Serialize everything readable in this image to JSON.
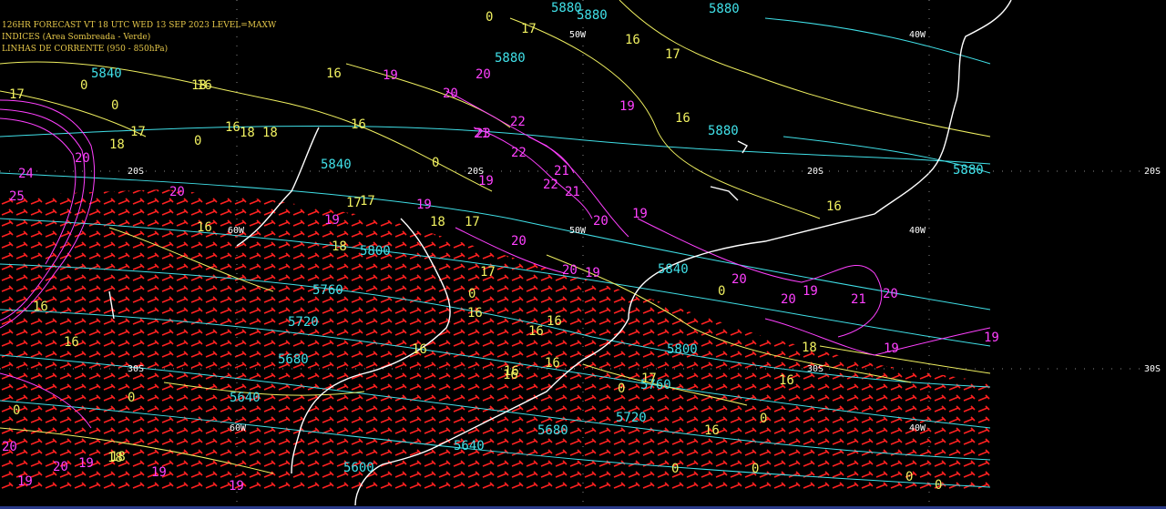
{
  "header": {
    "line1": "126HR FORECAST   VT 18 UTC WED 13 SEP 2023   LEVEL=MAXW",
    "line2": "INDICES (Area Sombreada - Verde)",
    "line3": "LINHAS DE CORRENTE (950 - 850hPa)"
  },
  "colors": {
    "background": "#000000",
    "heights_contour": "#40e0e8",
    "isotach_contour": "#f0f060",
    "index_contour": "#ff40ff",
    "wind_barbs": "#ff2020",
    "coastline": "#ffffff"
  },
  "grid_labels": {
    "lon": [
      "50W",
      "40W",
      "60W",
      "50W",
      "40W",
      "60W",
      "40W"
    ],
    "lat": [
      "20S",
      "20S",
      "20S",
      "20S",
      "30S",
      "30S",
      "30S"
    ]
  },
  "height_labels": [
    "5880",
    "5880",
    "5880",
    "5840",
    "5880",
    "5880",
    "5840",
    "5800",
    "5840",
    "5760",
    "5720",
    "5680",
    "5640",
    "5800",
    "5760",
    "5720",
    "5680",
    "5640",
    "5600",
    "5880"
  ],
  "isotach_labels": [
    "17",
    "16",
    "17",
    "16",
    "18",
    "16",
    "18",
    "17",
    "17",
    "18",
    "16",
    "16",
    "17",
    "18",
    "16",
    "16",
    "18",
    "16",
    "16",
    "18",
    "16",
    "17",
    "16",
    "16",
    "16",
    "17",
    "16",
    "18",
    "17",
    "18",
    "16",
    "16",
    "16",
    "16",
    "16",
    "17",
    "18"
  ],
  "index_labels": [
    "19",
    "20",
    "20",
    "21",
    "22",
    "22",
    "23",
    "21",
    "22",
    "20",
    "19",
    "20",
    "21",
    "20",
    "20",
    "19",
    "19",
    "20",
    "19",
    "20",
    "19",
    "20",
    "21",
    "20",
    "19",
    "19",
    "19",
    "19",
    "20",
    "19",
    "24",
    "25",
    "20",
    "19",
    "19",
    "19"
  ],
  "zero_labels": [
    "0",
    "0",
    "0",
    "0",
    "0",
    "0",
    "0",
    "0",
    "0",
    "0",
    "0",
    "0",
    "0",
    "0",
    "0"
  ]
}
